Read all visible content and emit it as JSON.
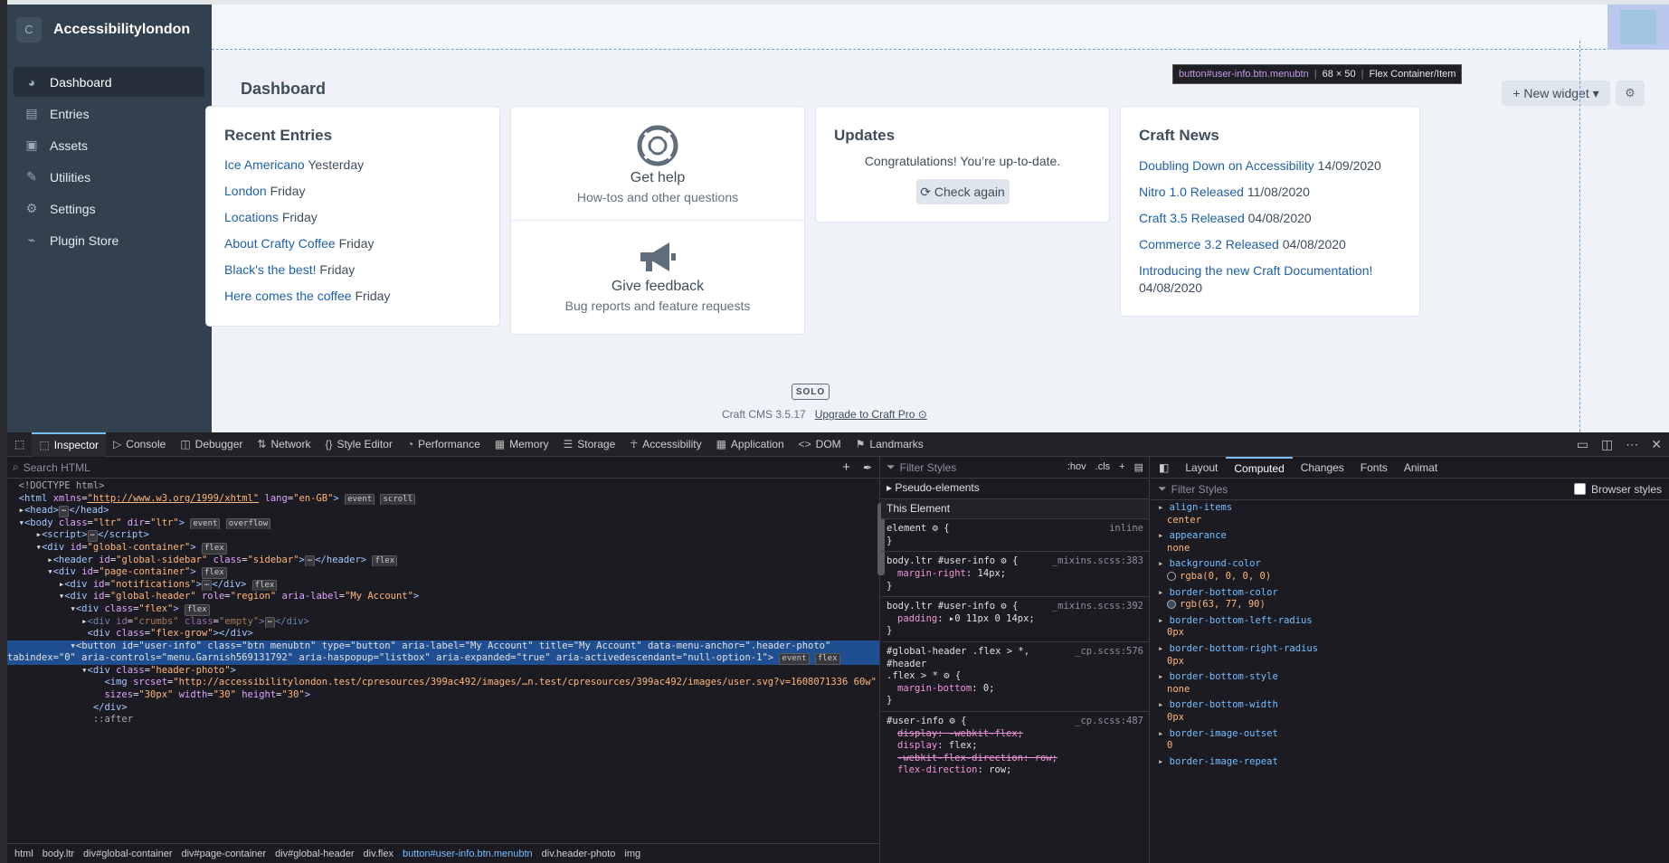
{
  "cms": {
    "site_initial": "C",
    "site_name": "Accessibilitylondon",
    "nav": [
      {
        "label": "Dashboard",
        "icon": "dashboard-icon",
        "glyph": "◕"
      },
      {
        "label": "Entries",
        "icon": "entries-icon",
        "glyph": "▤"
      },
      {
        "label": "Assets",
        "icon": "assets-icon",
        "glyph": "▣"
      },
      {
        "label": "Utilities",
        "icon": "utilities-icon",
        "glyph": "✎"
      },
      {
        "label": "Settings",
        "icon": "settings-icon",
        "glyph": "⚙"
      },
      {
        "label": "Plugin Store",
        "icon": "plug-icon",
        "glyph": "⌁"
      }
    ],
    "page_title": "Dashboard",
    "new_widget": "+ New widget ▾",
    "tooltip": {
      "selector": "button#user-info.btn.menubtn",
      "size": "68 × 50",
      "kind": "Flex Container/Item"
    },
    "recent": {
      "title": "Recent Entries",
      "items": [
        {
          "link": "Ice Americano",
          "when": "Yesterday"
        },
        {
          "link": "London",
          "when": "Friday"
        },
        {
          "link": "Locations",
          "when": "Friday"
        },
        {
          "link": "About Crafty Coffee",
          "when": "Friday"
        },
        {
          "link": "Black's the best!",
          "when": "Friday"
        },
        {
          "link": "Here comes the coffee",
          "when": "Friday"
        }
      ]
    },
    "help": {
      "title": "Get help",
      "sub": "How-tos and other questions",
      "feedback_title": "Give feedback",
      "feedback_sub": "Bug reports and feature requests"
    },
    "updates": {
      "title": "Updates",
      "message": "Congratulations! You’re up-to-date.",
      "button": "⟳ Check again"
    },
    "news": {
      "title": "Craft News",
      "items": [
        {
          "link": "Doubling Down on Accessibility",
          "date": "14/09/2020"
        },
        {
          "link": "Nitro 1.0 Released",
          "date": "11/08/2020"
        },
        {
          "link": "Craft 3.5 Released",
          "date": "04/08/2020"
        },
        {
          "link": "Commerce 3.2 Released",
          "date": "04/08/2020"
        },
        {
          "link": "Introducing the new Craft Documentation!",
          "date": "04/08/2020"
        }
      ]
    },
    "edition": "SOLO",
    "version": "Craft CMS 3.5.17",
    "upgrade": "Upgrade to Craft Pro ⊙"
  },
  "devtools": {
    "tabs": [
      {
        "label": "Inspector",
        "glyph": "⬚"
      },
      {
        "label": "Console",
        "glyph": "▷"
      },
      {
        "label": "Debugger",
        "glyph": "◫"
      },
      {
        "label": "Network",
        "glyph": "⇅"
      },
      {
        "label": "Style Editor",
        "glyph": "{}"
      },
      {
        "label": "Performance",
        "glyph": "◔"
      },
      {
        "label": "Memory",
        "glyph": "▦"
      },
      {
        "label": "Storage",
        "glyph": "☰"
      },
      {
        "label": "Accessibility",
        "glyph": "☥"
      },
      {
        "label": "Application",
        "glyph": "▦"
      },
      {
        "label": "DOM",
        "glyph": "<>"
      },
      {
        "label": "Landmarks",
        "glyph": "⚑"
      }
    ],
    "search_placeholder": "Search HTML",
    "filter_styles": "Filter Styles",
    "hov": ":hov",
    "cls": ".cls",
    "pseudo": "Pseudo-elements",
    "this_element": "This Element",
    "right_tabs": [
      "Layout",
      "Computed",
      "Changes",
      "Fonts",
      "Animat"
    ],
    "browser_styles": "Browser styles",
    "breadcrumbs": [
      "html",
      "body.ltr",
      "div#global-container",
      "div#page-container",
      "div#global-header",
      "div.flex",
      "button#user-info.btn.menubtn",
      "div.header-photo",
      "img"
    ],
    "computed": [
      {
        "name": "align-items",
        "value": "center"
      },
      {
        "name": "appearance",
        "value": "none"
      },
      {
        "name": "background-color",
        "value": "rgba(0, 0, 0, 0)"
      },
      {
        "name": "border-bottom-color",
        "value": "rgb(63, 77, 90)"
      },
      {
        "name": "border-bottom-left-radius",
        "value": "0px"
      },
      {
        "name": "border-bottom-right-radius",
        "value": "0px"
      },
      {
        "name": "border-bottom-style",
        "value": "none"
      },
      {
        "name": "border-bottom-width",
        "value": "0px"
      },
      {
        "name": "border-image-outset",
        "value": "0"
      },
      {
        "name": "border-image-repeat",
        "value": ""
      }
    ]
  }
}
